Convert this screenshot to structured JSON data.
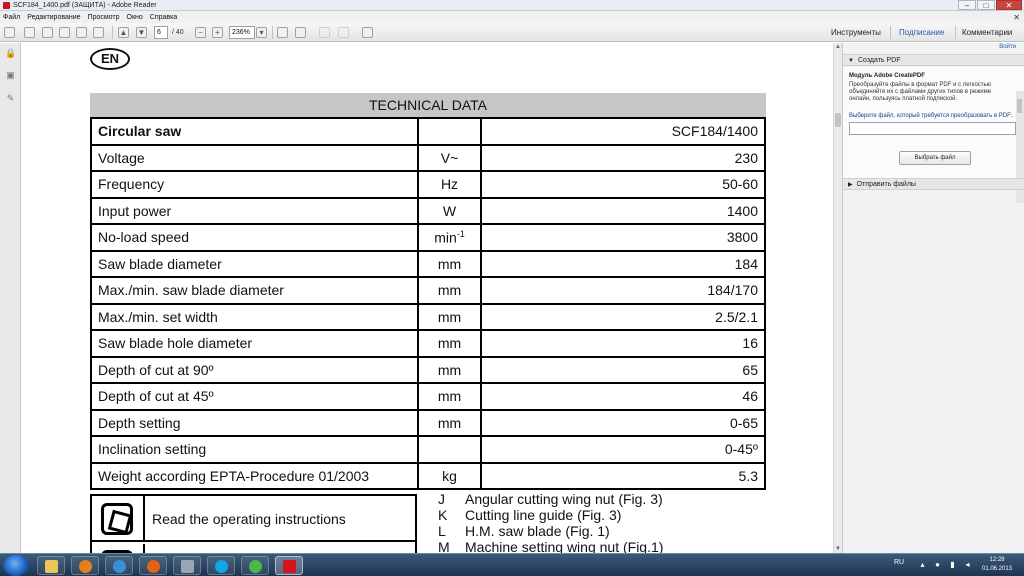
{
  "window": {
    "title": "SCF184_1400.pdf (ЗАЩИТА) - Adobe Reader",
    "minimize": "–",
    "maximize": "□",
    "close": "✕"
  },
  "menu": {
    "items": [
      "Файл",
      "Редактирование",
      "Просмотр",
      "Окно",
      "Справка"
    ],
    "close": "✕"
  },
  "toolbar": {
    "page_current": "6",
    "page_total": "/ 40",
    "zoom": "236%",
    "tools": "Инструменты",
    "sign": "Подписание",
    "comments": "Комментарии"
  },
  "document": {
    "lang_badge": "EN",
    "section_title": "TECHNICAL DATA",
    "rows": [
      {
        "name": "Circular saw",
        "unit": "",
        "value": "SCF184/1400"
      },
      {
        "name": "Voltage",
        "unit": "V~",
        "value": "230"
      },
      {
        "name": "Frequency",
        "unit": "Hz",
        "value": "50-60"
      },
      {
        "name": "Input power",
        "unit": "W",
        "value": "1400"
      },
      {
        "name": "No-load speed",
        "unit": "min",
        "unit_sup": "-1",
        "value": "3800"
      },
      {
        "name": "Saw blade diameter",
        "unit": "mm",
        "value": "184"
      },
      {
        "name": "Max./min. saw blade diameter",
        "unit": "mm",
        "value": "184/170"
      },
      {
        "name": "Max./min. set width",
        "unit": "mm",
        "value": "2.5/2.1"
      },
      {
        "name": "Saw blade hole diameter",
        "unit": "mm",
        "value": "16"
      },
      {
        "name": "Depth of cut at 90º",
        "unit": "mm",
        "value": "65"
      },
      {
        "name": "Depth of cut at 45º",
        "unit": "mm",
        "value": "46"
      },
      {
        "name": "Depth setting",
        "unit": "mm",
        "value": "0-65"
      },
      {
        "name": "Inclination setting",
        "unit": "",
        "value": "0-45º"
      },
      {
        "name": "Weight according EPTA-Procedure 01/2003",
        "unit": "kg",
        "value": "5.3"
      }
    ],
    "symbol_label": "Read the operating instructions",
    "legend": [
      {
        "key": "J",
        "text": "Angular cutting wing nut (Fig. 3)"
      },
      {
        "key": "K",
        "text": "Cutting line guide (Fig. 3)"
      },
      {
        "key": "L",
        "text": "H.M. saw blade (Fig. 1)"
      },
      {
        "key": "M",
        "text": "Machine setting wing nut (Fig.1)"
      }
    ]
  },
  "right_pane": {
    "login": "Войти",
    "section_create": "Создать PDF",
    "module_title": "Модуль Adobe CreatePDF",
    "module_desc": "Преобразуйте файлы в формат PDF и с легкостью объединяйте их с файлами других типов в режиме онлайн, пользуясь платной подпиской.",
    "choose_label": "Выберите файл, который требуется преобразовать в PDF:",
    "choose_button": "Выбрать файл",
    "section_send": "Отправить файлы"
  },
  "taskbar": {
    "lang": "RU",
    "time": "12:28",
    "date": "01.06.2013"
  }
}
